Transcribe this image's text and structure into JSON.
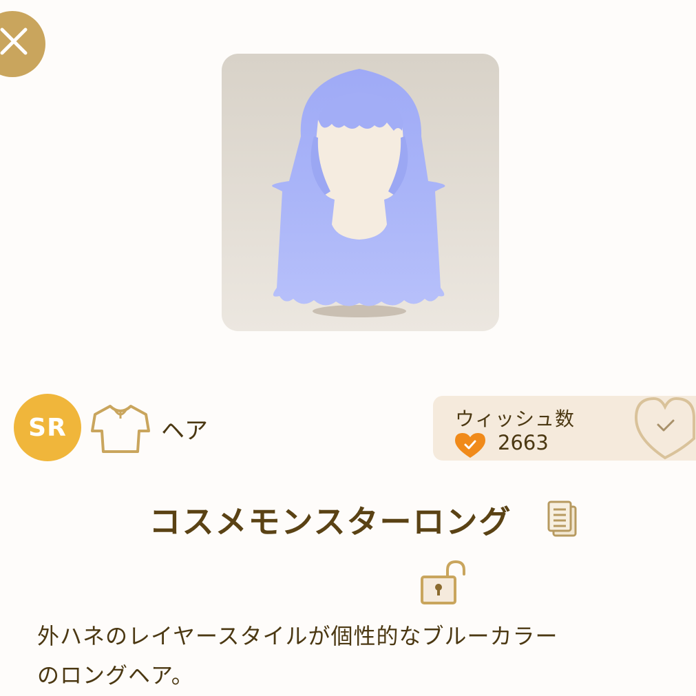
{
  "rarity": "SR",
  "category": "ヘア",
  "wish": {
    "label": "ウィッシュ数",
    "count": "2663"
  },
  "item": {
    "name": "コスメモンスターロング",
    "description_line1": "外ハネのレイヤースタイルが個性的なブルーカラー",
    "description_line2": "のロングヘア。"
  },
  "colors": {
    "accent_gold": "#c9a55d",
    "rarity_badge": "#f0b63b",
    "wish_heart": "#f08a1a",
    "text_brown": "#5a4214",
    "hair_blue": "#a8b3f7"
  },
  "icons": [
    "close-icon",
    "shirt-icon",
    "heart-check-icon",
    "copy-icon",
    "unlock-icon"
  ]
}
